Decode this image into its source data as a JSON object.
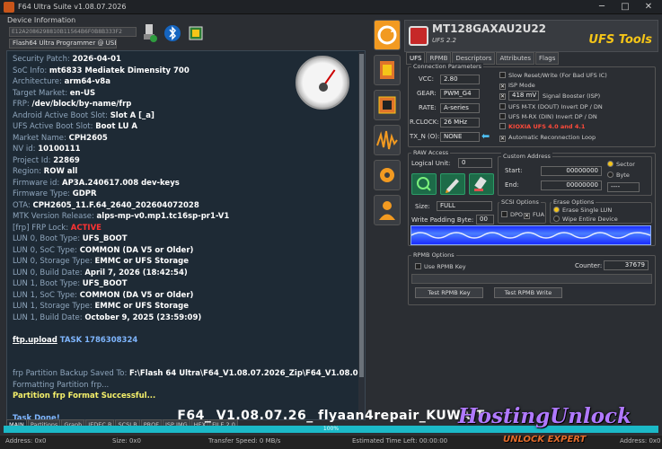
{
  "window": {
    "title": "F64 Ultra Suite v1.08.07.2026",
    "min": "─",
    "max": "□",
    "close": "✕"
  },
  "device_info": {
    "label": "Device Information",
    "device_id": "E12A2086298810B11564B6F0B8B333F2",
    "programmer": "Flash64 Ultra Programmer @ USB 3.2"
  },
  "log": {
    "lines": [
      {
        "k": "Security Patch: ",
        "v": "2026-04-01"
      },
      {
        "k": "SoC Info: ",
        "v": "mt6833 Mediatek Dimensity 700"
      },
      {
        "k": "Architecture: ",
        "v": "arm64-v8a"
      },
      {
        "k": "Target Market: ",
        "v": "en-US"
      },
      {
        "k": "FRP: ",
        "v": "/dev/block/by-name/frp"
      },
      {
        "k": "Android Active Boot Slot: ",
        "v": "Slot A [_a]"
      },
      {
        "k": "UFS Active Boot Slot: ",
        "v": "Boot LU A"
      },
      {
        "k": "Market Name: ",
        "v": "CPH2605"
      },
      {
        "k": "NV id: ",
        "v": "10100111"
      },
      {
        "k": "Project Id: ",
        "v": "22869"
      },
      {
        "k": "Region: ",
        "v": "ROW all"
      },
      {
        "k": "Firmware id: ",
        "v": "AP3A.240617.008 dev-keys"
      },
      {
        "k": "Firmware Type: ",
        "v": "GDPR"
      },
      {
        "k": "OTA: ",
        "v": "CPH2605_11.F.64_2640_202604072028"
      },
      {
        "k": "MTK Version Release: ",
        "v": "alps-mp-v0.mp1.tc16sp-pr1-V1"
      },
      {
        "k": "[frp] FRP Lock: ",
        "v": "ACTIVE",
        "red": true
      },
      {
        "k": "LUN 0, Boot Type: ",
        "v": "UFS_BOOT"
      },
      {
        "k": "LUN 0, SoC Type: ",
        "v": "COMMON (DA V5 or Older)"
      },
      {
        "k": "LUN 0, Storage Type: ",
        "v": "EMMC or UFS Storage"
      },
      {
        "k": "LUN 0, Build Date: ",
        "v": "April 7, 2026 (18:42:54)"
      },
      {
        "k": "LUN 1, Boot Type: ",
        "v": "UFS_BOOT"
      },
      {
        "k": "LUN 1, SoC Type: ",
        "v": "COMMON (DA V5 or Older)"
      },
      {
        "k": "LUN 1, Storage Type: ",
        "v": "EMMC or UFS Storage"
      },
      {
        "k": "LUN 1, Build Date: ",
        "v": "October 9, 2025 (23:59:09)"
      }
    ],
    "ftp_cmd": "ftp.upload",
    "ftp_task": " TASK 1786308324",
    "backup_k": "frp Partition Backup Saved To: ",
    "backup_v": "F:\\Flash 64  Ultra\\F64_V1.08.07.2026_Zip\\F64_V1.08.07.2026_Zi",
    "formatting": "Formatting Partition frp...",
    "format_ok": "Partition frp Format Successful...",
    "done": "Task Done!"
  },
  "bottom_tabs": [
    "MAIN",
    "Partitions",
    "Graph",
    "JEDEC B",
    "SCSI B",
    "PROF",
    "ISP IMG",
    "HEX",
    "FILE 2.0"
  ],
  "banner": "F64_ V1.08.07.26_ flyaan4repair_KUWAIT",
  "progress": {
    "label": "100%",
    "value": 100
  },
  "status": {
    "address": "Address: 0x0",
    "size": "Size: 0x0",
    "speed": "Transfer Speed: 0 MB/s",
    "eta": "Estimated Time Left: 00:00:00",
    "address2": "Address: 0x0"
  },
  "watermark": {
    "main": "HostingUnlock",
    "sub": "UNLOCK EXPERT"
  },
  "ufs_header": {
    "model": "MT128GAXAU2U22",
    "sub": "UFS 2.2",
    "brand": "UFS Tools"
  },
  "right_tabs": [
    "UFS",
    "RPMB",
    "Descriptors",
    "Attributes",
    "Flags"
  ],
  "conn": {
    "label": "Connection Parameters",
    "vcc_l": "VCC:",
    "vcc": "2.80",
    "gear_l": "GEAR:",
    "gear": "PWM_G4",
    "rate_l": "RATE:",
    "rate": "A-series",
    "rclock_l": "R.CLOCK:",
    "rclock": "26 MHz",
    "txn_l": "TX_N (O):",
    "txn": "NONE",
    "slow_reset": "Slow Reset/Write (For Bad UFS IC)",
    "isp_mode": "ISP Mode",
    "booster": "418 mV",
    "booster_l": "Signal Booster (ISP)",
    "mtx": "UFS M-TX (DOUT) Invert DP / DN",
    "mrx": "UFS M-RX (DIN) Invert DP / DN",
    "kioxia": "KIOXIA UFS 4.0 and 4.1",
    "auto_reconnect": "Automatic Reconnection Loop"
  },
  "raw": {
    "label": "RAW Access",
    "lu_l": "Logical Unit:",
    "lu": "0",
    "custom_label": "Custom Address",
    "start_l": "Start:",
    "start": "00000000",
    "end_l": "End:",
    "end": "00000000",
    "sector": "Sector",
    "byte": "Byte",
    "unit_sel": "----",
    "size_l": "Size:",
    "size": "FULL",
    "pad_l": "Write Padding Byte:",
    "pad": "00",
    "scsi_label": "SCSI Options",
    "dpo": "DPO",
    "fua": "FUA",
    "erase_label": "Erase Options",
    "erase_single": "Erase Single LUN",
    "wipe": "Wipe Entire Device"
  },
  "rpmb": {
    "label": "RPMB Options",
    "use": "Use RPMB Key",
    "counter_l": "Counter:",
    "counter": "37679",
    "test_key": "Test RPMB Key",
    "test_write": "Test RPMB Write"
  },
  "colors": {
    "accent_cyan": "#1bb9c7",
    "brand_yellow": "#f5c518",
    "log_bg": "#1e2a35",
    "wave_blue": "#1a2cff"
  }
}
